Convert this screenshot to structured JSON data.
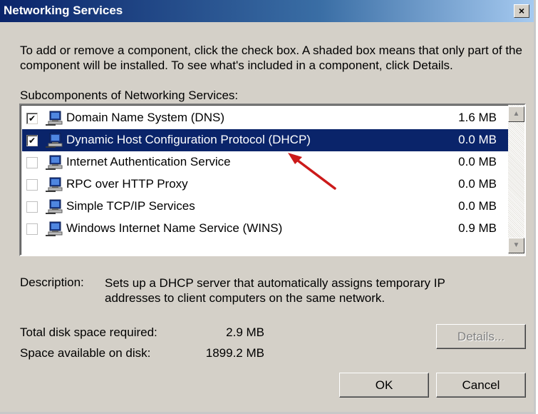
{
  "window": {
    "title": "Networking Services",
    "close_glyph": "×"
  },
  "intro_text": "To add or remove a component, click the check box. A shaded box means that only part of the component will be installed. To see what's included in a component, click Details.",
  "list_label": "Subcomponents of Networking Services:",
  "components": [
    {
      "name": "Domain Name System (DNS)",
      "size": "1.6 MB",
      "checked": true,
      "selected": false,
      "icon": "network-computer-icon"
    },
    {
      "name": "Dynamic Host Configuration Protocol (DHCP)",
      "size": "0.0 MB",
      "checked": true,
      "selected": true,
      "icon": "network-computer-icon"
    },
    {
      "name": "Internet Authentication Service",
      "size": "0.0 MB",
      "checked": false,
      "selected": false,
      "icon": "network-computer-icon"
    },
    {
      "name": "RPC over HTTP Proxy",
      "size": "0.0 MB",
      "checked": false,
      "selected": false,
      "icon": "network-computer-icon"
    },
    {
      "name": "Simple TCP/IP Services",
      "size": "0.0 MB",
      "checked": false,
      "selected": false,
      "icon": "network-computer-icon"
    },
    {
      "name": "Windows Internet Name Service (WINS)",
      "size": "0.9 MB",
      "checked": false,
      "selected": false,
      "icon": "network-computer-icon"
    }
  ],
  "description": {
    "label": "Description:",
    "text": "Sets up a DHCP server that automatically assigns temporary IP addresses to client computers on the same network."
  },
  "disk": {
    "required_label": "Total disk space required:",
    "required_value": "2.9 MB",
    "available_label": "Space available on disk:",
    "available_value": "1899.2 MB"
  },
  "buttons": {
    "details": "Details...",
    "ok": "OK",
    "cancel": "Cancel"
  },
  "colors": {
    "selection": "#0a246a",
    "dialog_bg": "#d4d0c8",
    "annotation_arrow": "#cc1a1a"
  }
}
